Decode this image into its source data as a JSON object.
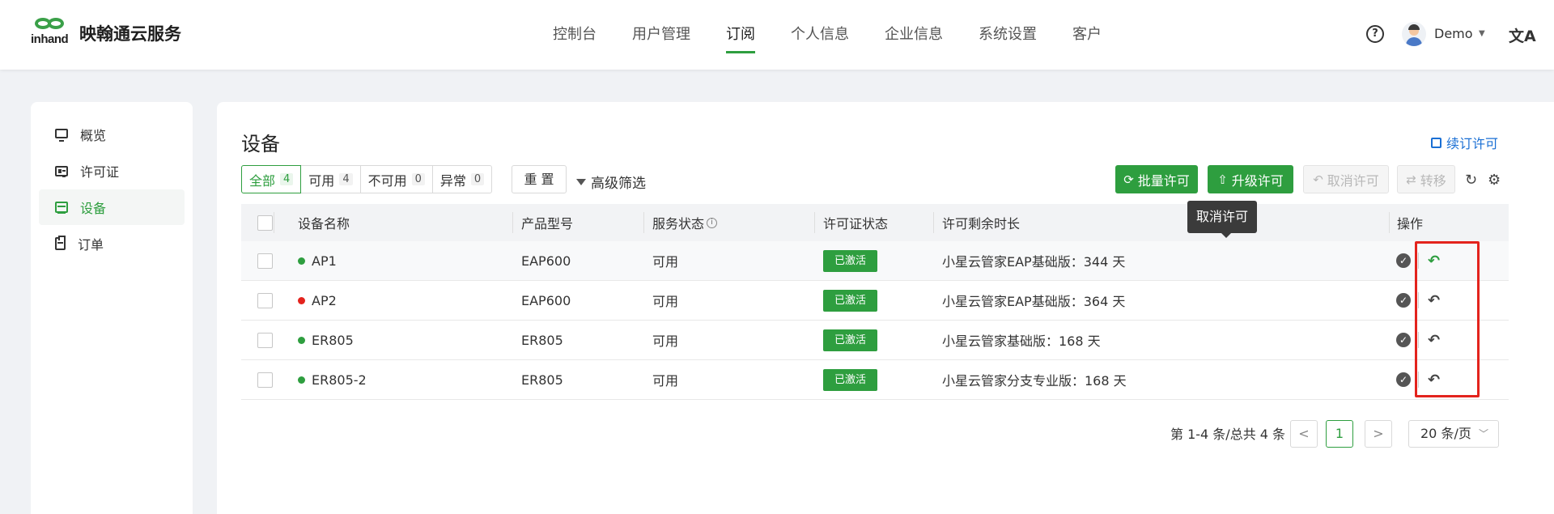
{
  "header": {
    "brand_word": "inhand",
    "brand_name": "映翰通云服务",
    "nav": [
      "控制台",
      "用户管理",
      "订阅",
      "个人信息",
      "企业信息",
      "系统设置",
      "客户"
    ],
    "active_nav": 2,
    "help": "?",
    "user_name": "Demo",
    "lang_icon": "文A"
  },
  "sidebar": {
    "items": [
      {
        "label": "概览",
        "icon": "dashboard-icon"
      },
      {
        "label": "许可证",
        "icon": "license-icon"
      },
      {
        "label": "设备",
        "icon": "device-icon"
      },
      {
        "label": "订单",
        "icon": "order-icon"
      }
    ],
    "active": 2
  },
  "main": {
    "title": "设备",
    "renew_link": "续订许可",
    "filters": [
      {
        "label": "全部",
        "count": "4"
      },
      {
        "label": "可用",
        "count": "4"
      },
      {
        "label": "不可用",
        "count": "0"
      },
      {
        "label": "异常",
        "count": "0"
      }
    ],
    "reset": "重 置",
    "advanced_filter": "高级筛选",
    "actions": {
      "batch": "批量许可",
      "upgrade": "升级许可",
      "revoke": "取消许可",
      "transfer": "转移"
    }
  },
  "table": {
    "headers": {
      "name": "设备名称",
      "model": "产品型号",
      "service": "服务状态",
      "license": "许可证状态",
      "remaining": "许可剩余时长",
      "ops": "操作"
    },
    "rows": [
      {
        "name": "AP1",
        "status_color": "#2e9e3f",
        "model": "EAP600",
        "service": "可用",
        "license": "已激活",
        "remaining": "小星云管家EAP基础版：344 天"
      },
      {
        "name": "AP2",
        "status_color": "#e3231d",
        "model": "EAP600",
        "service": "可用",
        "license": "已激活",
        "remaining": "小星云管家EAP基础版：364 天"
      },
      {
        "name": "ER805",
        "status_color": "#2e9e3f",
        "model": "ER805",
        "service": "可用",
        "license": "已激活",
        "remaining": "小星云管家基础版：168 天"
      },
      {
        "name": "ER805-2",
        "status_color": "#2e9e3f",
        "model": "ER805",
        "service": "可用",
        "license": "已激活",
        "remaining": "小星云管家分支专业版：168 天"
      }
    ]
  },
  "tooltip": "取消许可",
  "pagination": {
    "total": "第 1-4 条/总共 4 条",
    "prev": "<",
    "current": "1",
    "next": ">",
    "page_size": "20 条/页"
  },
  "colors": {
    "accent": "#2e9e3f",
    "danger": "#e3231d",
    "link": "#1a6fd4"
  }
}
